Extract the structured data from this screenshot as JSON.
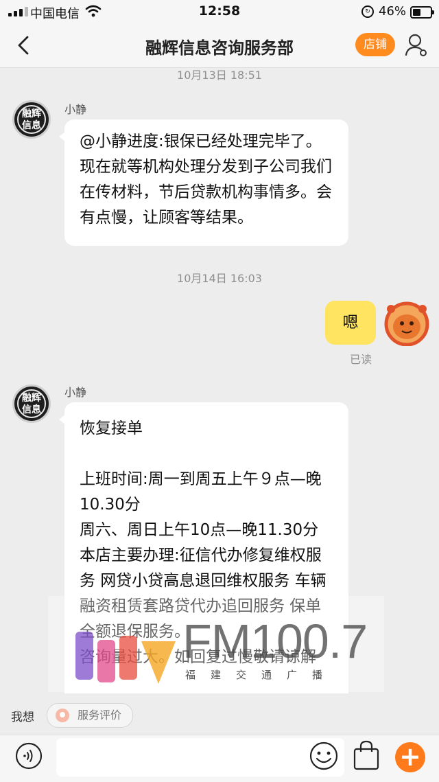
{
  "status_bar": {
    "carrier": "中国电信",
    "time": "12:58",
    "battery_percent": "46%",
    "battery_level": 0.46
  },
  "header": {
    "title": "融辉信息咨询服务部",
    "shop_button": "店铺"
  },
  "messages": [
    {
      "timestamp": "10月13日 18:51",
      "sender": "小静",
      "avatar_text": "融辉\n信息",
      "text": "@小静进度:银保已经处理完毕了。现在就等机构处理分发到子公司我们在传材料，节后贷款机构事情多。会有点慢，让顾客等结果。"
    },
    {
      "timestamp": "10月14日 16:03",
      "mine": true,
      "text": "嗯",
      "status": "已读"
    },
    {
      "sender": "小静",
      "avatar_text": "融辉\n信息",
      "text": "恢复接单\n\n上班时间:周一到周五上午９点—晚10.30分\n周六、周日上午10点—晚11.30分\n本店主要办理:征信代办修复维权服务  网贷小贷高息退回维权服务   车辆融资租赁套路贷代办追回服务  保单全额退保服务。\n咨询量过大。如回复过慢敬请谅解"
    }
  ],
  "watermark": {
    "brand": "FM100.7",
    "subtitle": "福建交通广播"
  },
  "quick_replies": {
    "label": "我想",
    "chips": [
      "服务评价"
    ]
  },
  "input_bar": {
    "placeholder": ""
  },
  "colors": {
    "accent": "#ff8a1e",
    "my_bubble": "#ffe462",
    "background": "#ededed"
  }
}
